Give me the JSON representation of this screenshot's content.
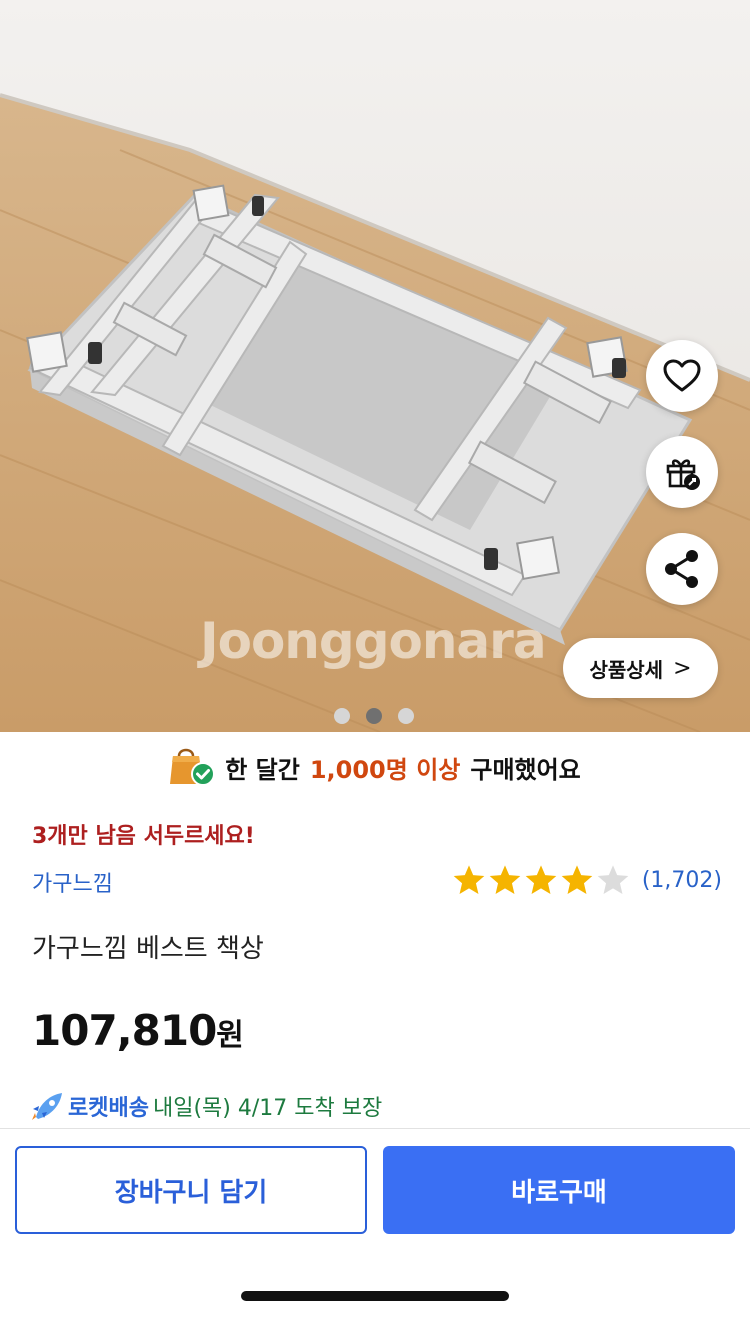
{
  "gallery": {
    "watermark": "Joonggonara",
    "detail_button_label": "상품상세",
    "detail_button_chevron": ">",
    "dot_count": 3,
    "active_dot_index": 1
  },
  "actions": {
    "wishlist_icon": "heart-icon",
    "gift_icon": "gift-icon",
    "share_icon": "share-icon"
  },
  "purchase_banner": {
    "prefix": "한 달간",
    "highlight": "1,000명 이상",
    "suffix": "구매했어요"
  },
  "stock_notice": "3개만 남음 서두르세요!",
  "brand": "가구느낌",
  "rating": {
    "stars": 4,
    "max_stars": 5,
    "count_text": "(1,702)"
  },
  "product_title": "가구느낌 베스트 책상",
  "price": {
    "amount": "107,810",
    "unit": "원"
  },
  "delivery": {
    "label": "로켓배송",
    "text": "내일(목) 4/17 도착 보장"
  },
  "buttons": {
    "add_to_cart": "장바구니 담기",
    "buy_now": "바로구매"
  },
  "colors": {
    "primary_blue": "#3a6ff3",
    "link_blue": "#2962c8",
    "stock_red": "#ad1f1f",
    "highlight_orange": "#d0470f",
    "delivery_green": "#1d7a3f",
    "star_gold": "#f5b400"
  }
}
